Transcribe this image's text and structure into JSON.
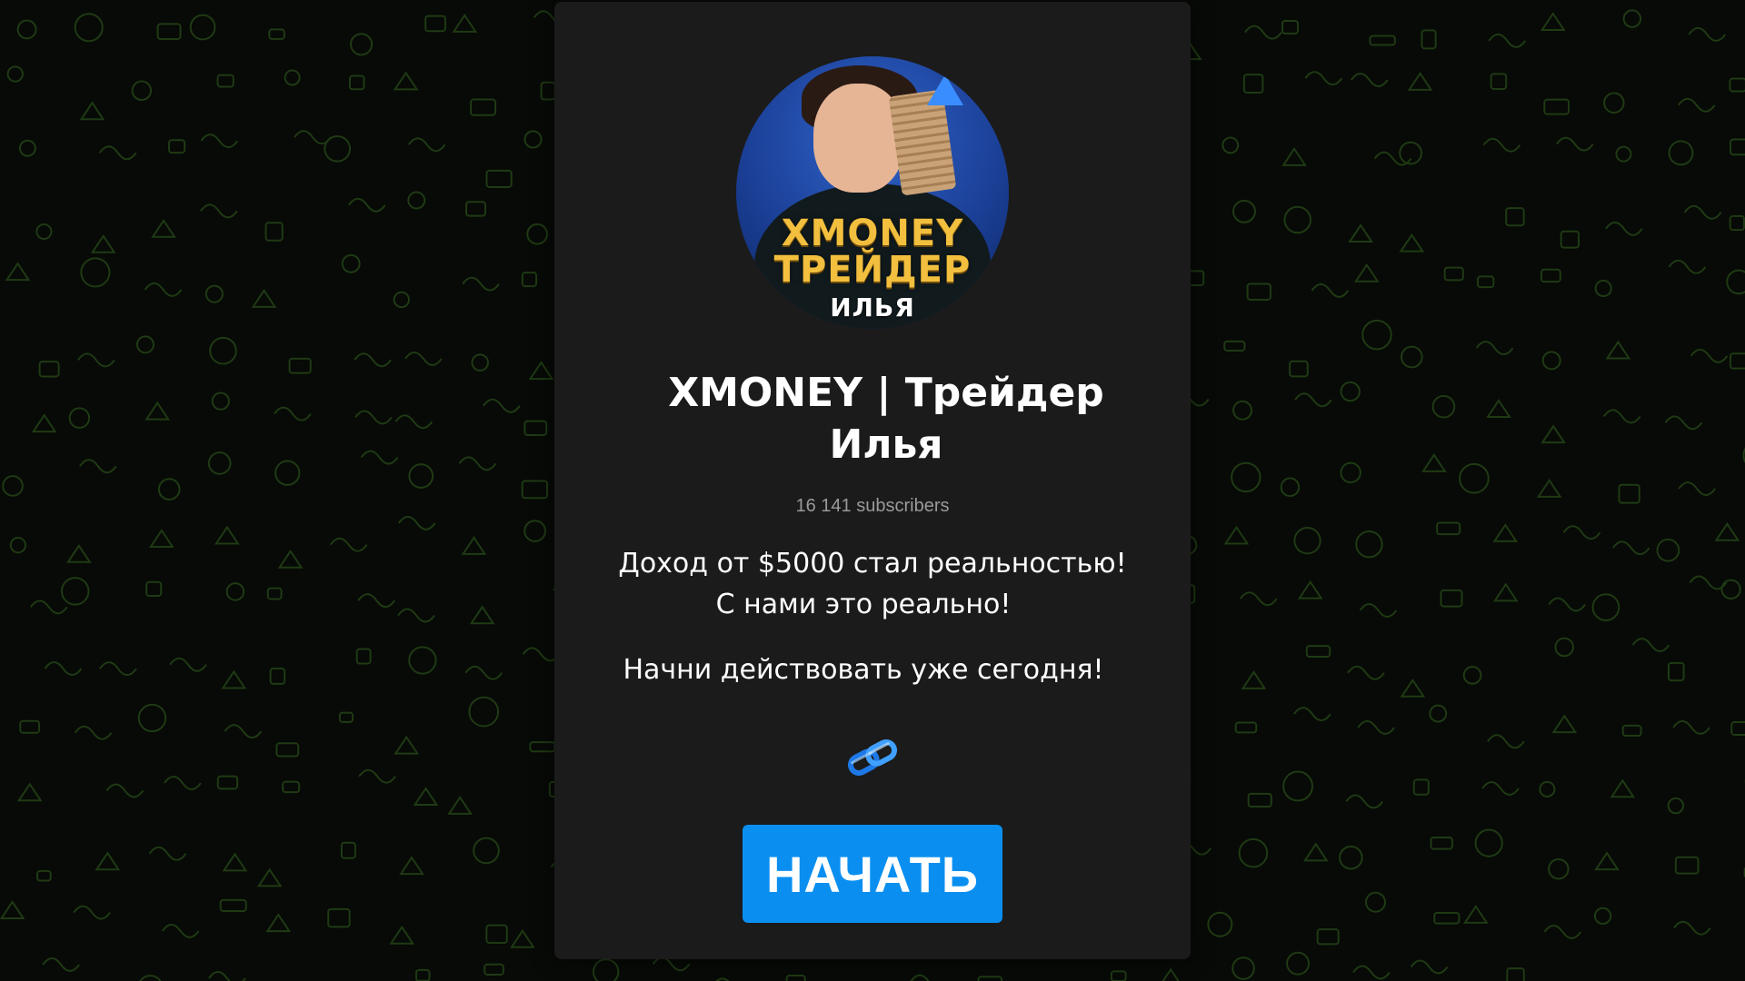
{
  "channel": {
    "avatar": {
      "brand_line_1": "XMONEY",
      "brand_line_2": "ТРЕЙДЕР",
      "brand_line_3": "ИЛЬЯ"
    },
    "title_line_1": "XMONEY | Трейдер",
    "title_line_2": "Илья",
    "subscribers": "16 141 subscribers",
    "description_line_1": "Доход от $5000 стал реальностью!",
    "description_line_2": "С нами это реально!",
    "call_to_action": "Начни действовать уже сегодня!",
    "link_icon": "link-emoji-icon"
  },
  "button": {
    "start_label": "НАЧАТЬ"
  },
  "colors": {
    "background": "#070a06",
    "pattern": "#1f3a14",
    "card": "#1b1b1b",
    "button": "#0a8ff0",
    "subscribers_text": "#9a9a9a"
  }
}
